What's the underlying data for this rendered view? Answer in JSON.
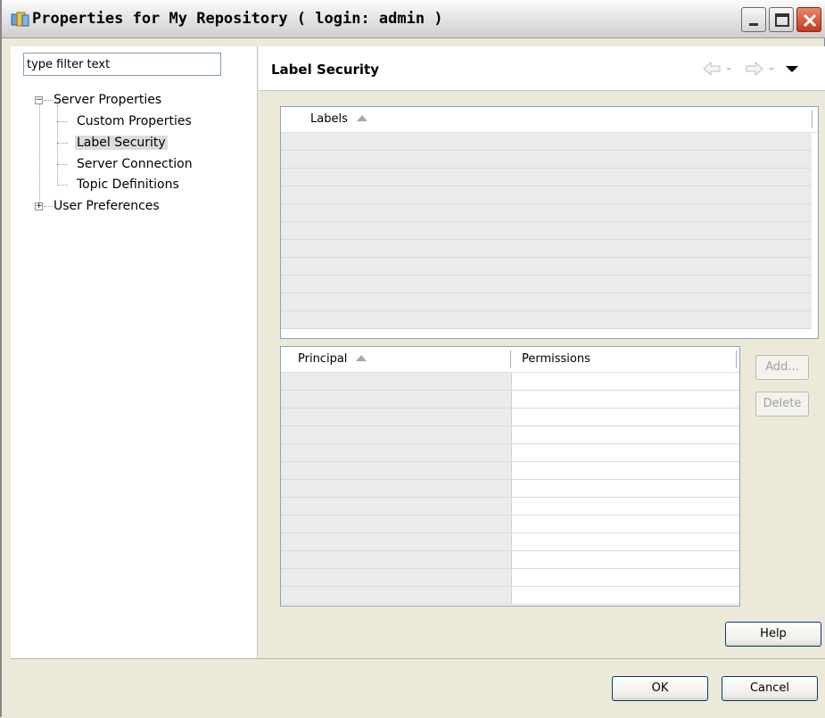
{
  "window": {
    "title": "Properties for My Repository ( login: admin )",
    "controls": [
      "minimize-icon",
      "maximize-icon",
      "close-icon"
    ]
  },
  "filter": {
    "value": "type filter text"
  },
  "tree": {
    "server_properties": "Server Properties",
    "children": [
      "Custom Properties",
      "Label Security",
      "Server Connection",
      "Topic Definitions"
    ],
    "user_preferences": "User Preferences",
    "selected": "Label Security"
  },
  "page": {
    "title": "Label Security",
    "nav_icons": [
      "back-arrow-icon",
      "forward-arrow-icon",
      "view-menu-icon"
    ]
  },
  "labels_table": {
    "headers": [
      "Labels"
    ],
    "rows": []
  },
  "principal_table": {
    "headers": [
      "Principal",
      "Permissions"
    ],
    "rows": []
  },
  "buttons": {
    "add": "Add...",
    "delete": "Delete",
    "help": "Help",
    "ok": "OK",
    "cancel": "Cancel"
  }
}
